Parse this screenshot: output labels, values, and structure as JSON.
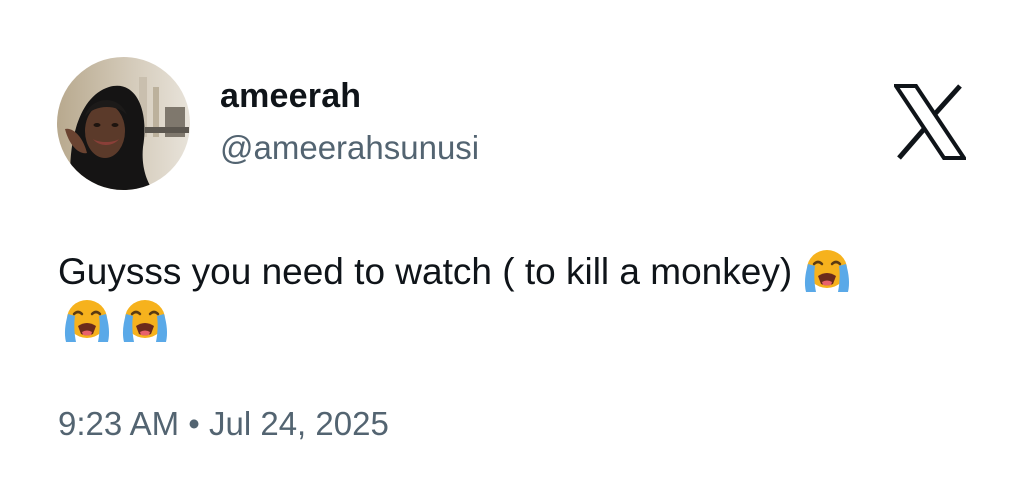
{
  "author": {
    "display_name": "ameerah",
    "handle": "@ameerahsunusi",
    "avatar_icon": "profile-photo"
  },
  "brand": {
    "icon": "x-logo-icon"
  },
  "tweet": {
    "text": "Guysss you need to watch ( to kill a monkey)",
    "emojis": [
      "loudly-crying-face",
      "loudly-crying-face",
      "loudly-crying-face"
    ]
  },
  "meta": {
    "time": "9:23 AM",
    "separator": "•",
    "date": "Jul 24, 2025"
  },
  "colors": {
    "text_primary": "#0f1419",
    "text_secondary": "#536471",
    "background": "#ffffff"
  }
}
